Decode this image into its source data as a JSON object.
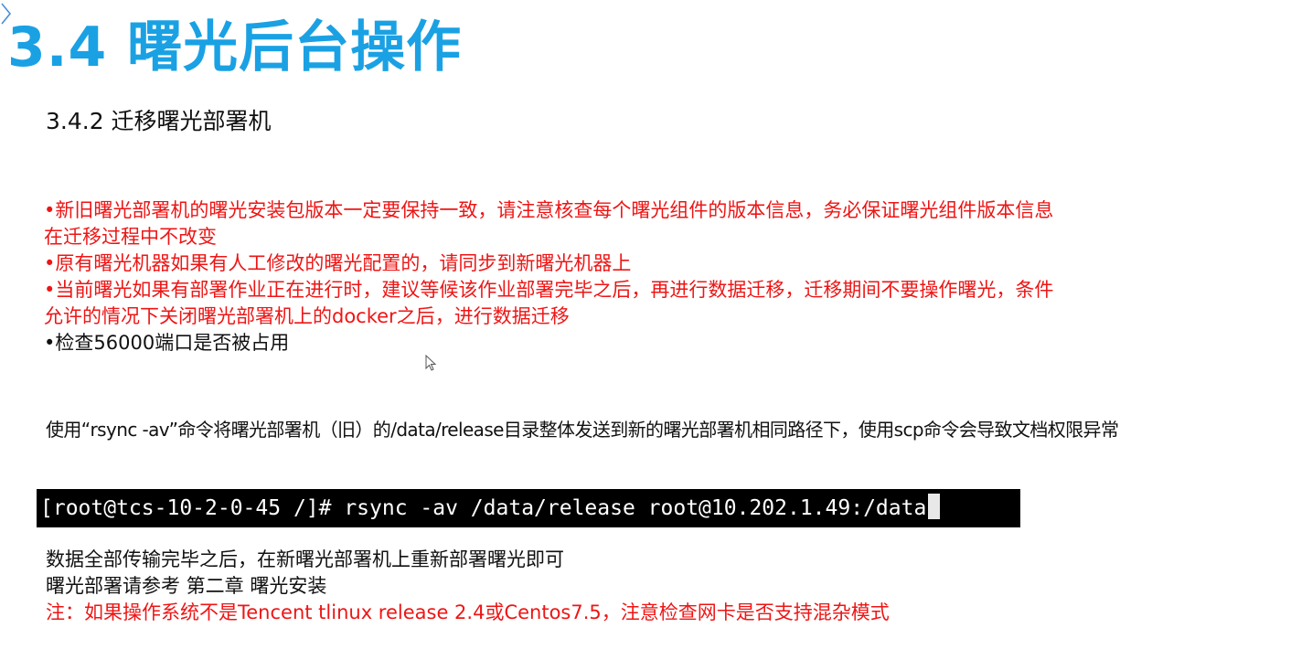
{
  "title": "3.4 曙光后台操作",
  "subtitle": "3.4.2 迁移曙光部署机",
  "notes": [
    {
      "line1": "•新旧曙光部署机的曙光安装包版本一定要保持一致，请注意核查每个曙光组件的版本信息，务必保证曙光组件版本信息",
      "line2": "在迁移过程中不改变"
    },
    {
      "line1": "•原有曙光机器如果有人工修改的曙光配置的，请同步到新曙光机器上"
    },
    {
      "line1": "•当前曙光如果有部署作业正在进行时，建议等候该作业部署完毕之后，再进行数据迁移，迁移期间不要操作曙光，条件",
      "line2": "允许的情况下关闭曙光部署机上的docker之后，进行数据迁移"
    },
    {
      "line1": "•检查56000端口是否被占用"
    }
  ],
  "description": "使用“rsync -av”命令将曙光部署机（旧）的/data/release目录整体发送到新的曙光部署机相同路径下，使用scp命令会导致文档权限异常",
  "terminal": {
    "command": "[root@tcs-10-2-0-45 /]# rsync -av /data/release root@10.202.1.49:/data"
  },
  "after_lines": [
    "数据全部传输完毕之后，在新曙光部署机上重新部署曙光即可",
    "曙光部署请参考 第二章 曙光安装"
  ],
  "warning": "注：如果操作系统不是Tencent tlinux release 2.4或Centos7.5，注意检查网卡是否支持混杂模式",
  "colors": {
    "title": "#1aa1e4",
    "warning": "#ee1515",
    "text": "#111111",
    "terminal_bg": "#000000"
  },
  "icons": [
    "corner-chevron-icon",
    "mouse-pointer-icon"
  ]
}
